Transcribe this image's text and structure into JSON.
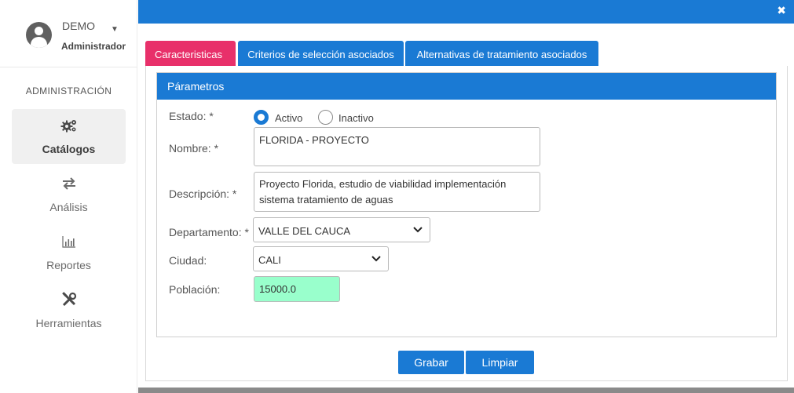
{
  "user": {
    "name": "DEMO",
    "role": "Administrador"
  },
  "sidebar": {
    "section": "ADMINISTRACIÓN",
    "items": [
      {
        "label": "Catálogos",
        "icon": "gears-icon",
        "active": true
      },
      {
        "label": "Análisis",
        "icon": "exchange-icon",
        "active": false
      },
      {
        "label": "Reportes",
        "icon": "bar-chart-icon",
        "active": false
      },
      {
        "label": "Herramientas",
        "icon": "tools-icon",
        "active": false
      }
    ]
  },
  "tabs": [
    {
      "label": "Caracteristicas",
      "active": true
    },
    {
      "label": "Criterios de selección asociados",
      "active": false
    },
    {
      "label": "Alternativas de tratamiento asociados",
      "active": false
    }
  ],
  "panel": {
    "title": "Párametros"
  },
  "form": {
    "estado": {
      "label": "Estado:",
      "required": "*",
      "options": [
        "Activo",
        "Inactivo"
      ],
      "selected": "Activo"
    },
    "nombre": {
      "label": "Nombre:",
      "required": "*",
      "value": "FLORIDA - PROYECTO"
    },
    "descripcion": {
      "label": "Descripción:",
      "required": "*",
      "value": "Proyecto Florida, estudio de viabilidad implementación sistema tratamiento de aguas"
    },
    "departamento": {
      "label": "Departamento:",
      "required": "*",
      "value": "VALLE DEL CAUCA"
    },
    "ciudad": {
      "label": "Ciudad:",
      "value": "CALI"
    },
    "poblacion": {
      "label": "Población:",
      "value": "15000.0"
    }
  },
  "buttons": {
    "save": "Grabar",
    "clear": "Limpiar"
  },
  "colors": {
    "primary": "#1a7ad4",
    "active_tab": "#e8306a",
    "population_bg": "#99ffcc"
  }
}
